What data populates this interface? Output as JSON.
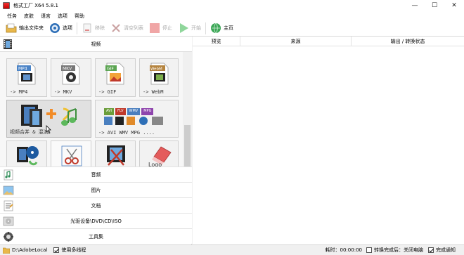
{
  "window": {
    "title": "格式工厂 X64 5.8.1"
  },
  "menu": [
    "任务",
    "皮肤",
    "语言",
    "选项",
    "帮助"
  ],
  "toolbar": {
    "output_folder": "输出文件夹",
    "options": "选项",
    "remove": "移除",
    "clear_list": "清空列表",
    "stop": "停止",
    "start": "开始",
    "home": "主页"
  },
  "left": {
    "video_header": "视频",
    "tiles": [
      {
        "label": "-> MP4",
        "badge": "MP4"
      },
      {
        "label": "-> MKV",
        "badge": "MKV"
      },
      {
        "label": "-> GIF",
        "badge": "GIF"
      },
      {
        "label": "-> WebM",
        "badge": "WebM"
      },
      {
        "label": "视频合并 & 混流"
      },
      {
        "label": "-> AVI WMV MPG ....",
        "formats": [
          "AVI",
          "FLV",
          "WMV",
          "MPG"
        ]
      },
      {
        "label": ""
      },
      {
        "label": ""
      },
      {
        "label": ""
      },
      {
        "label": "",
        "text": "Logo"
      }
    ],
    "categories": [
      "音频",
      "图片",
      "文档",
      "光驱设备\\DVD\\CD\\ISO",
      "工具集"
    ]
  },
  "right": {
    "columns": [
      "预览",
      "来源",
      "输出 / 转换状态"
    ]
  },
  "status": {
    "path": "D:\\AdobeLocal",
    "multithread": "使用多线程",
    "elapsed": "耗时：00:00:00",
    "shutdown": "转换完成后：关闭电脑",
    "notify": "完成通知"
  },
  "colors": {
    "accent_green": "#2fb84a",
    "red_stop": "#e04545"
  }
}
